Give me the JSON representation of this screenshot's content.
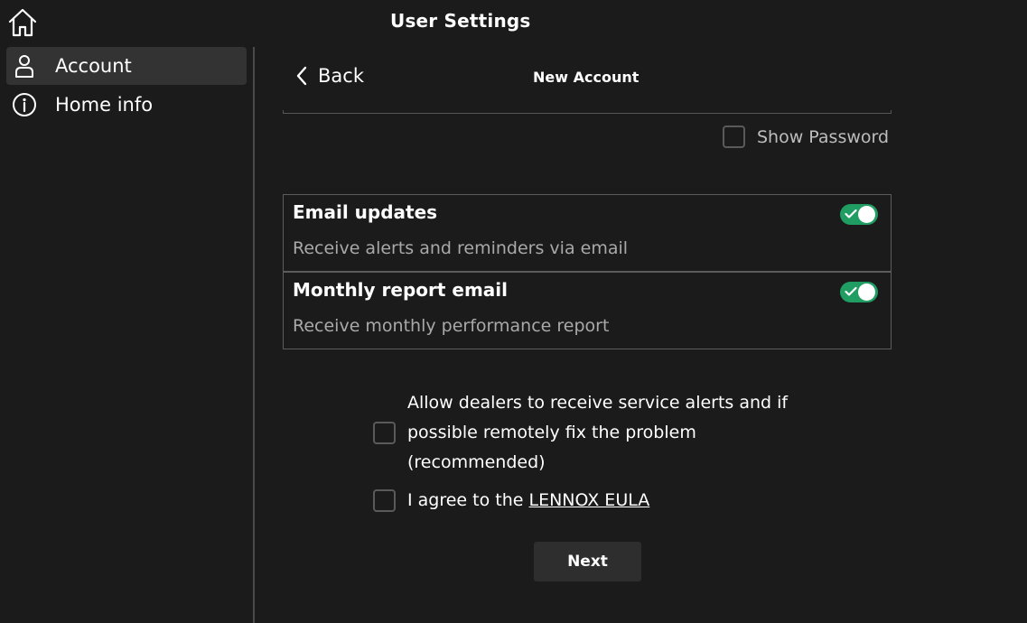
{
  "header": {
    "title": "User Settings",
    "home_icon": "home-icon"
  },
  "sidebar": {
    "items": [
      {
        "label": "Account",
        "icon": "person-icon",
        "active": true
      },
      {
        "label": "Home info",
        "icon": "info-icon",
        "active": false
      }
    ]
  },
  "main": {
    "back_label": "Back",
    "title": "New Account",
    "show_password": {
      "label": "Show Password",
      "checked": false
    },
    "options": [
      {
        "title": "Email updates",
        "description": "Receive alerts and reminders via email",
        "enabled": true
      },
      {
        "title": "Monthly report email",
        "description": "Receive monthly performance report",
        "enabled": true
      }
    ],
    "dealer_alerts": {
      "line1": "Allow dealers to receive service alerts and if",
      "line2": "possible remotely fix the problem",
      "line3": "(recommended)",
      "checked": false
    },
    "eula": {
      "prefix": "I agree to the ",
      "link": "LENNOX EULA",
      "checked": false
    },
    "next_label": "Next"
  },
  "colors": {
    "background": "#1b1b1b",
    "toggle_on": "#1f9d63",
    "active_item": "#333333"
  }
}
